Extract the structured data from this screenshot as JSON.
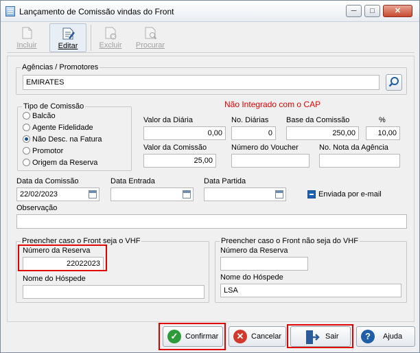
{
  "window": {
    "title": "Lançamento de Comissão vindas do Front",
    "minimize": "─",
    "maximize": "□",
    "close": "✕"
  },
  "toolbar": {
    "incluir": "Incluir",
    "editar": "Editar",
    "excluir": "Excluir",
    "procurar": "Procurar"
  },
  "agencias": {
    "label": "Agências  / Promotores",
    "value": "EMIRATES"
  },
  "status_text": "Não Integrado com o CAP",
  "tipo_comissao": {
    "title": "Tipo de Comissão",
    "options": [
      "Balcão",
      "Agente Fidelidade",
      "Não Desc. na Fatura",
      "Promotor",
      "Origem da Reserva"
    ],
    "selected": "Não Desc. na Fatura"
  },
  "valores": {
    "valor_diaria_label": "Valor da Diária",
    "valor_diaria": "0,00",
    "no_diarias_label": "No. Diárias",
    "no_diarias": "0",
    "base_comissao_label": "Base da Comissão",
    "base_comissao": "250,00",
    "percent_label": "%",
    "percent": "10,00",
    "valor_comissao_label": "Valor da Comissão",
    "valor_comissao": "25,00",
    "numero_voucher_label": "Número do Voucher",
    "numero_voucher": "",
    "nota_agencia_label": "No. Nota da Agência",
    "nota_agencia": ""
  },
  "datas": {
    "data_comissao_label": "Data da Comissão",
    "data_comissao": "22/02/2023",
    "data_entrada_label": "Data Entrada",
    "data_entrada": "",
    "data_partida_label": "Data Partida",
    "data_partida": "",
    "enviada_email_label": "Enviada por e-mail"
  },
  "observacao": {
    "label": "Observação",
    "value": ""
  },
  "vhf": {
    "title": "Preencher caso o Front seja o VHF",
    "numero_reserva_label": "Número da Reserva",
    "numero_reserva": "22022023",
    "nome_hospede_label": "Nome do Hóspede",
    "nome_hospede": ""
  },
  "nao_vhf": {
    "title": "Preencher caso o Front não seja do VHF",
    "numero_reserva_label": "Número da Reserva",
    "numero_reserva": "",
    "nome_hospede_label": "Nome do Hóspede",
    "nome_hospede": "LSA"
  },
  "buttons": {
    "confirmar": "Confirmar",
    "cancelar": "Cancelar",
    "sair": "Sair",
    "ajuda": "Ajuda"
  },
  "colors": {
    "status_red": "#e00000",
    "highlight_red": "#e00000",
    "confirm_green": "#2e9b3a",
    "cancel_red": "#d0392b",
    "help_blue": "#1f5fa8"
  }
}
